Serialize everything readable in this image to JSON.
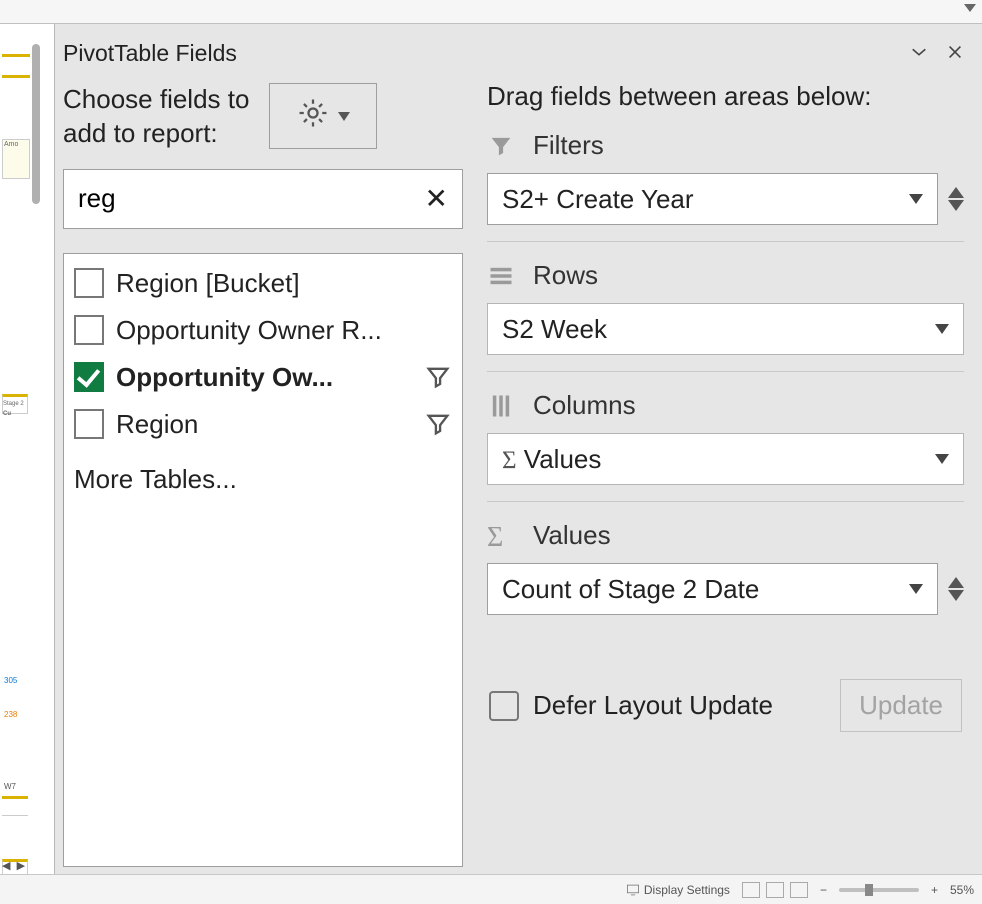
{
  "pane": {
    "title": "PivotTable Fields"
  },
  "choose": {
    "text1": "Choose fields to",
    "text2": "add to report:"
  },
  "search": {
    "value": "reg"
  },
  "fields": [
    {
      "label": "Region [Bucket]",
      "checked": false,
      "filter": false
    },
    {
      "label": "Opportunity Owner R...",
      "checked": false,
      "filter": false
    },
    {
      "label": "Opportunity Ow...",
      "checked": true,
      "filter": true
    },
    {
      "label": "Region",
      "checked": false,
      "filter": true
    }
  ],
  "moreTables": "More Tables...",
  "drag": {
    "title": "Drag fields between areas below:"
  },
  "areas": {
    "filters": {
      "title": "Filters",
      "item": "S2+ Create Year"
    },
    "rows": {
      "title": "Rows",
      "item": "S2 Week"
    },
    "columns": {
      "title": "Columns",
      "item": "Values",
      "sigma": "Σ"
    },
    "values": {
      "title": "Values",
      "item": "Count of Stage 2 Date",
      "sigma": "Σ"
    }
  },
  "defer": {
    "label": "Defer Layout Update",
    "button": "Update"
  },
  "status": {
    "display": "Display Settings",
    "zoom": "55%"
  },
  "left": {
    "amo": "Amo",
    "s2": "Stage 2",
    "cu": "Cu",
    "n1": "305",
    "n2": "238",
    "wk": "W7"
  }
}
